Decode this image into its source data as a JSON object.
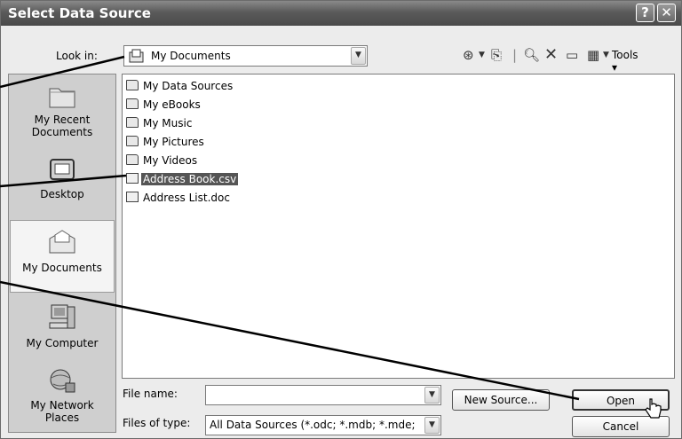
{
  "dialog": {
    "title": "Select Data Source",
    "help_glyph": "?",
    "close_glyph": "✕"
  },
  "lookin": {
    "label": "Look in:",
    "value": "My Documents",
    "tools_label": "Tools"
  },
  "places": [
    {
      "label_line1": "My Recent",
      "label_line2": "Documents",
      "icon": "recent-documents-icon"
    },
    {
      "label_line1": "Desktop",
      "label_line2": "",
      "icon": "desktop-icon"
    },
    {
      "label_line1": "My Documents",
      "label_line2": "",
      "icon": "my-documents-icon",
      "selected": true
    },
    {
      "label_line1": "My Computer",
      "label_line2": "",
      "icon": "my-computer-icon"
    },
    {
      "label_line1": "My Network",
      "label_line2": "Places",
      "icon": "network-places-icon"
    }
  ],
  "files": [
    {
      "name": "My Data Sources",
      "type": "folder"
    },
    {
      "name": "My eBooks",
      "type": "folder"
    },
    {
      "name": "My Music",
      "type": "folder"
    },
    {
      "name": "My Pictures",
      "type": "folder"
    },
    {
      "name": "My Videos",
      "type": "folder"
    },
    {
      "name": "Address Book.csv",
      "type": "csv",
      "selected": true
    },
    {
      "name": "Address List.doc",
      "type": "doc"
    }
  ],
  "filename": {
    "label": "File name:",
    "value": ""
  },
  "filetype": {
    "label": "Files of type:",
    "value": "All Data Sources (*.odc; *.mdb; *.mde;"
  },
  "buttons": {
    "new_source": "New Source...",
    "open": "Open",
    "cancel": "Cancel"
  },
  "colors": {
    "titlebar": "#5a5a5a",
    "selection": "#555555",
    "callout_lines": "#000000"
  }
}
